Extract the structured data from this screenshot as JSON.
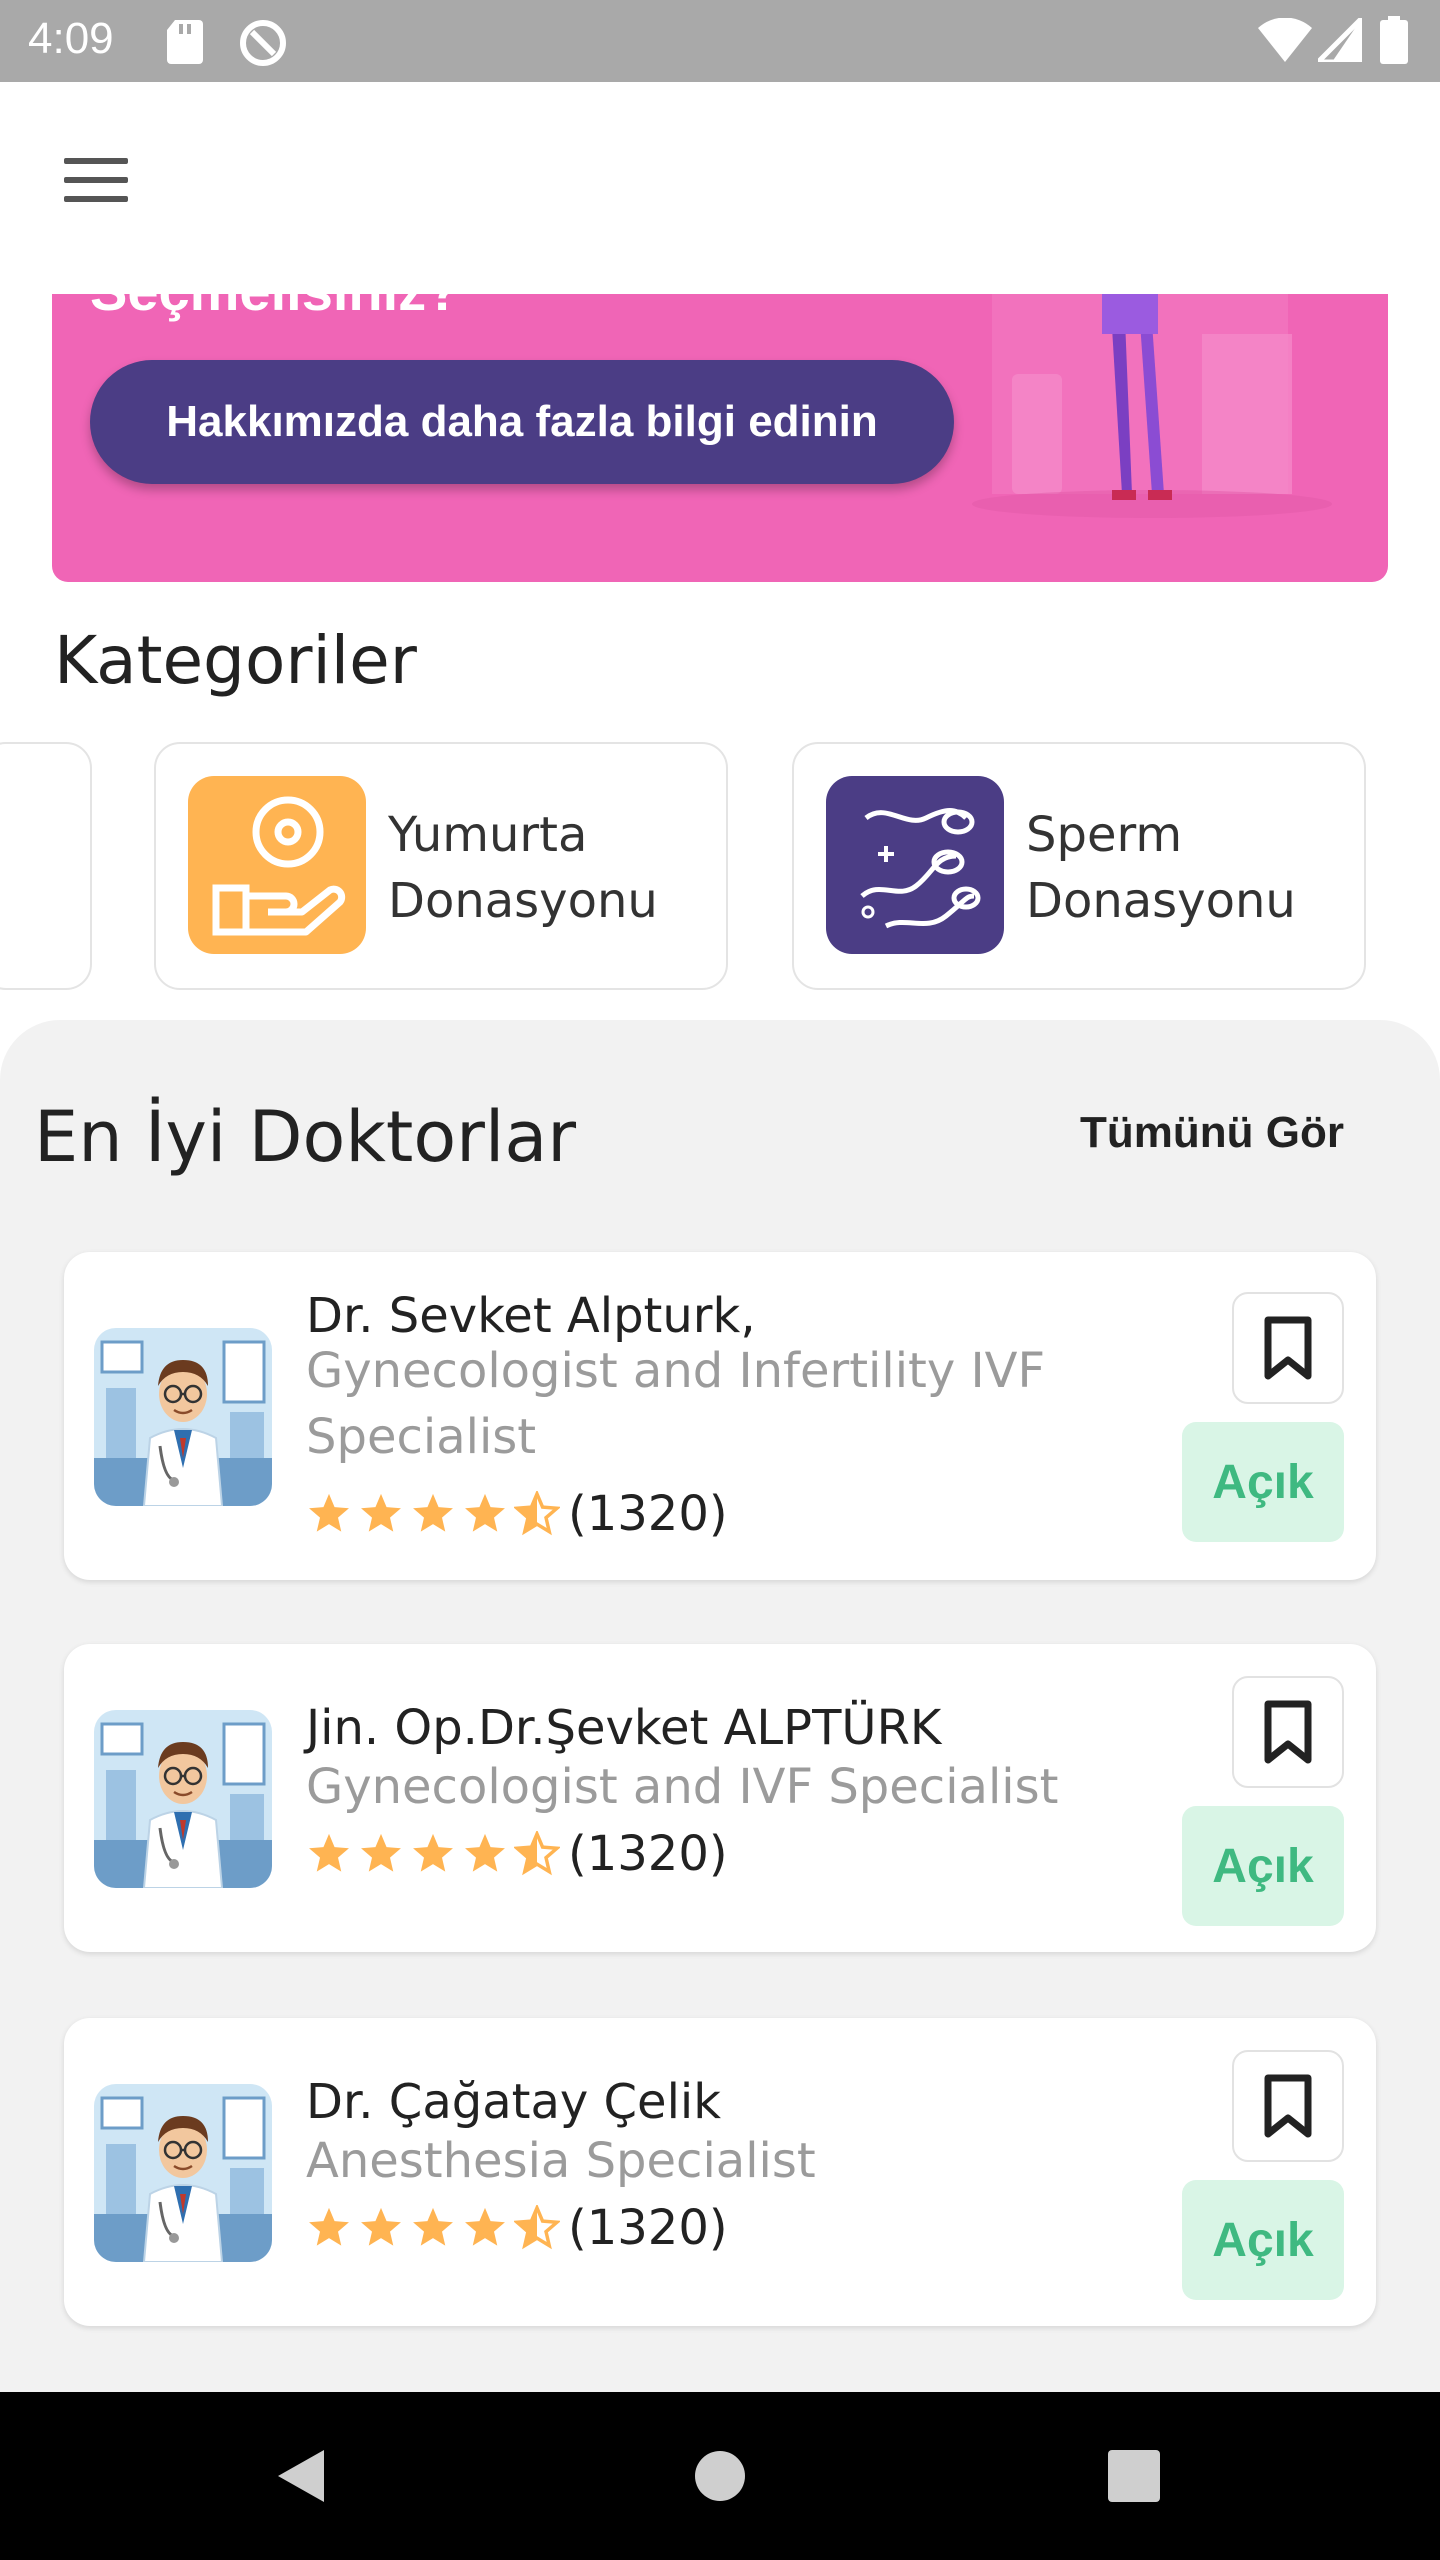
{
  "status_bar": {
    "time": "4:09",
    "icons": [
      "sd-card-icon",
      "sync-icon",
      "wifi-icon",
      "cellular-icon",
      "battery-icon"
    ]
  },
  "app_bar": {
    "menu_icon": "hamburger-menu-icon"
  },
  "banner": {
    "title": "Seçmelisiniz?",
    "button_label": "Hakkımızda daha fazla bilgi edinin",
    "background_color": "#f065b6",
    "button_color": "#4b3d85"
  },
  "categories": {
    "title": "Kategoriler",
    "items": [
      {
        "label_line1": "Yumurta",
        "label_line2": "Donasyonu",
        "icon": "egg-donation-icon",
        "color": "#ffb452"
      },
      {
        "label_line1": "Sperm",
        "label_line2": "Donasyonu",
        "icon": "sperm-donation-icon",
        "color": "#4b3d85"
      }
    ]
  },
  "doctors": {
    "title": "En İyi Doktorlar",
    "see_all_label": "Tümünü Gör",
    "items": [
      {
        "name": "Dr. Sevket Alpturk,",
        "specialty": "Gynecologist and Infertility IVF Specialist",
        "rating": 4.5,
        "rating_count": "(1320)",
        "status_label": "Açık"
      },
      {
        "name": "Jin. Op.Dr.Şevket ALPTÜRK",
        "specialty": "Gynecologist and IVF Specialist",
        "rating": 4.5,
        "rating_count": "(1320)",
        "status_label": "Açık"
      },
      {
        "name": "Dr. Çağatay Çelik",
        "specialty": "Anesthesia Specialist",
        "rating": 4.5,
        "rating_count": "(1320)",
        "status_label": "Açık"
      }
    ]
  },
  "nav_bar": {
    "icons": [
      "back-icon",
      "home-icon",
      "recents-icon"
    ]
  },
  "colors": {
    "star": "#ffb452",
    "open_text": "#3fb981",
    "open_bg": "#d9f5e6"
  }
}
